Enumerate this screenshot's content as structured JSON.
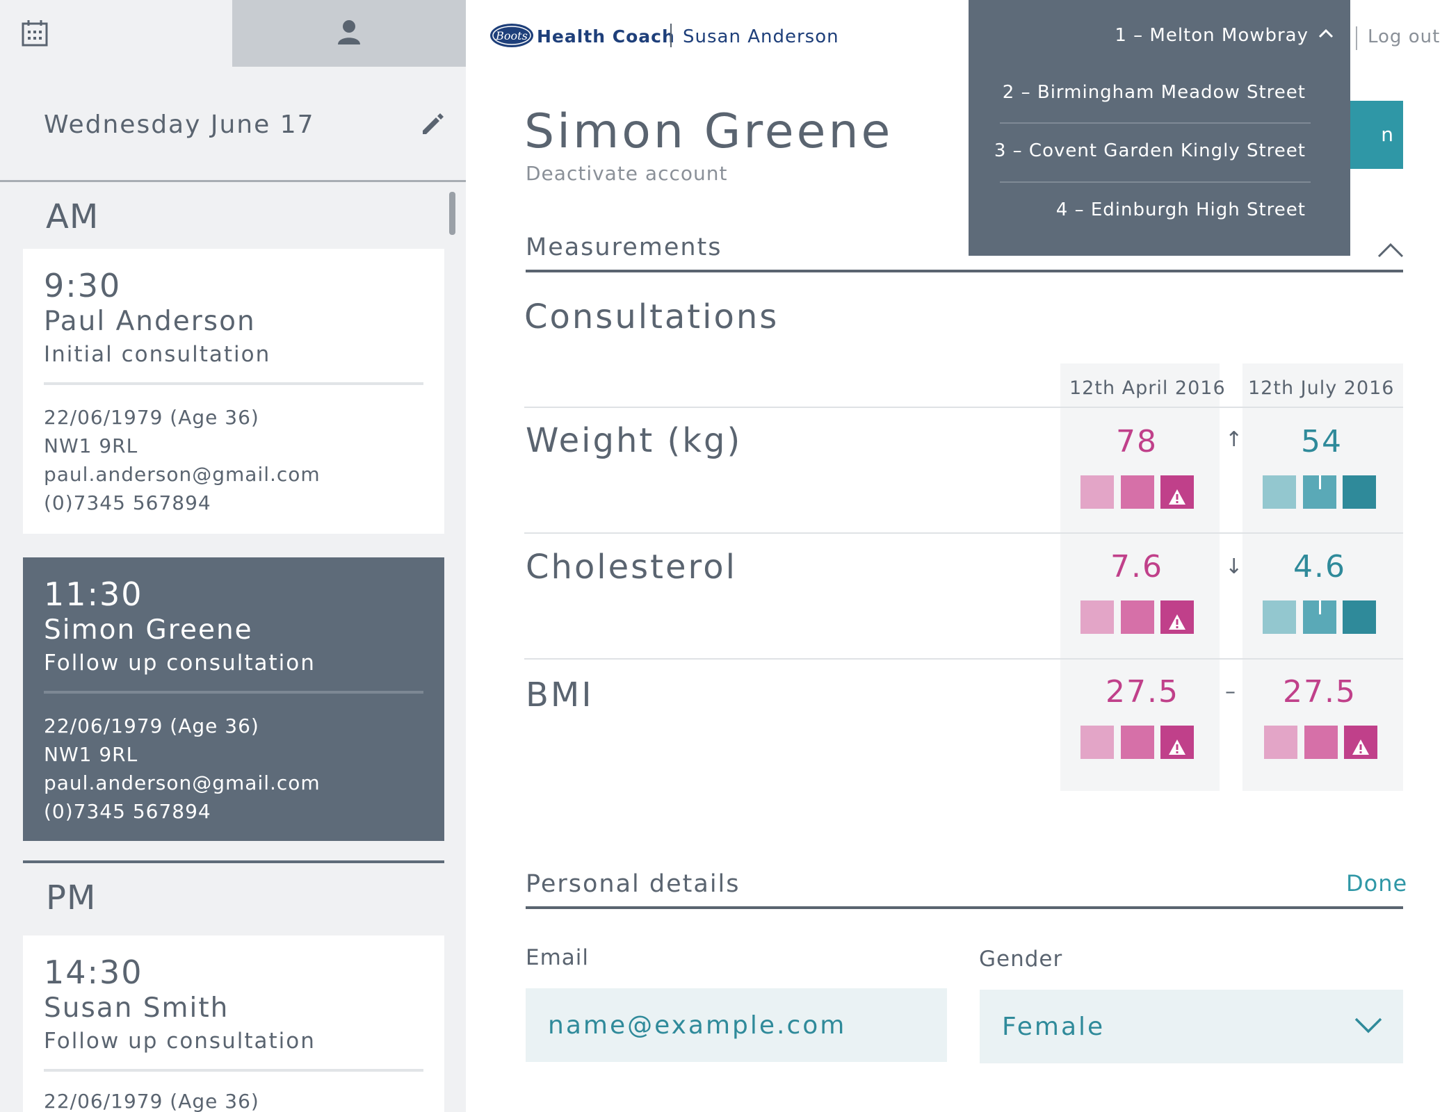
{
  "sidebar": {
    "tabs": [
      {
        "icon": "calendar-icon"
      },
      {
        "icon": "person-icon"
      }
    ],
    "date": "Wednesday June 17",
    "edit_icon": "pencil-icon",
    "am_label": "AM",
    "pm_label": "PM",
    "appointments": [
      {
        "time": "9:30",
        "name": "Paul Anderson",
        "type": "Initial consultation",
        "dob": "22/06/1979 (Age 36)",
        "postcode": "NW1 9RL",
        "email": "paul.anderson@gmail.com",
        "phone": "(0)7345 567894"
      },
      {
        "time": "11:30",
        "name": "Simon Greene",
        "type": "Follow up consultation",
        "dob": "22/06/1979 (Age 36)",
        "postcode": "NW1 9RL",
        "email": "paul.anderson@gmail.com",
        "phone": "(0)7345 567894"
      },
      {
        "time": "14:30",
        "name": "Susan Smith",
        "type": "Follow up consultation",
        "dob": "22/06/1979 (Age 36)"
      }
    ]
  },
  "header": {
    "logo": "Boots",
    "brand": "Health Coach",
    "coach_name": "Susan Anderson",
    "logout": "Log out"
  },
  "store_dropdown": {
    "current": "1 – Melton Mowbray",
    "options": [
      "2 – Birmingham Meadow Street",
      "3 – Covent Garden Kingly Street",
      "4 – Edinburgh High Street"
    ]
  },
  "patient": {
    "name": "Simon Greene",
    "deactivate": "Deactivate account"
  },
  "measurements": {
    "header": "Measurements",
    "consultations_title": "Consultations",
    "dates": [
      "12th April 2016",
      "12th July 2016"
    ],
    "rows": [
      {
        "label": "Weight (kg)",
        "values": [
          "78",
          "54"
        ],
        "trend": "↑"
      },
      {
        "label": "Cholesterol",
        "values": [
          "7.6",
          "4.6"
        ],
        "trend": "↓"
      },
      {
        "label": "BMI",
        "values": [
          "27.5",
          "27.5"
        ],
        "trend": "–"
      }
    ]
  },
  "personal_details": {
    "header": "Personal details",
    "done": "Done",
    "email_label": "Email",
    "email_placeholder": "name@example.com",
    "gender_label": "Gender",
    "gender_value": "Female"
  },
  "colors": {
    "sidebar_bg": "#f0f1f3",
    "active_card": "#5e6b79",
    "accent_teal": "#2f97a6",
    "pink": "#c0408a",
    "navy": "#1e3f7a"
  }
}
